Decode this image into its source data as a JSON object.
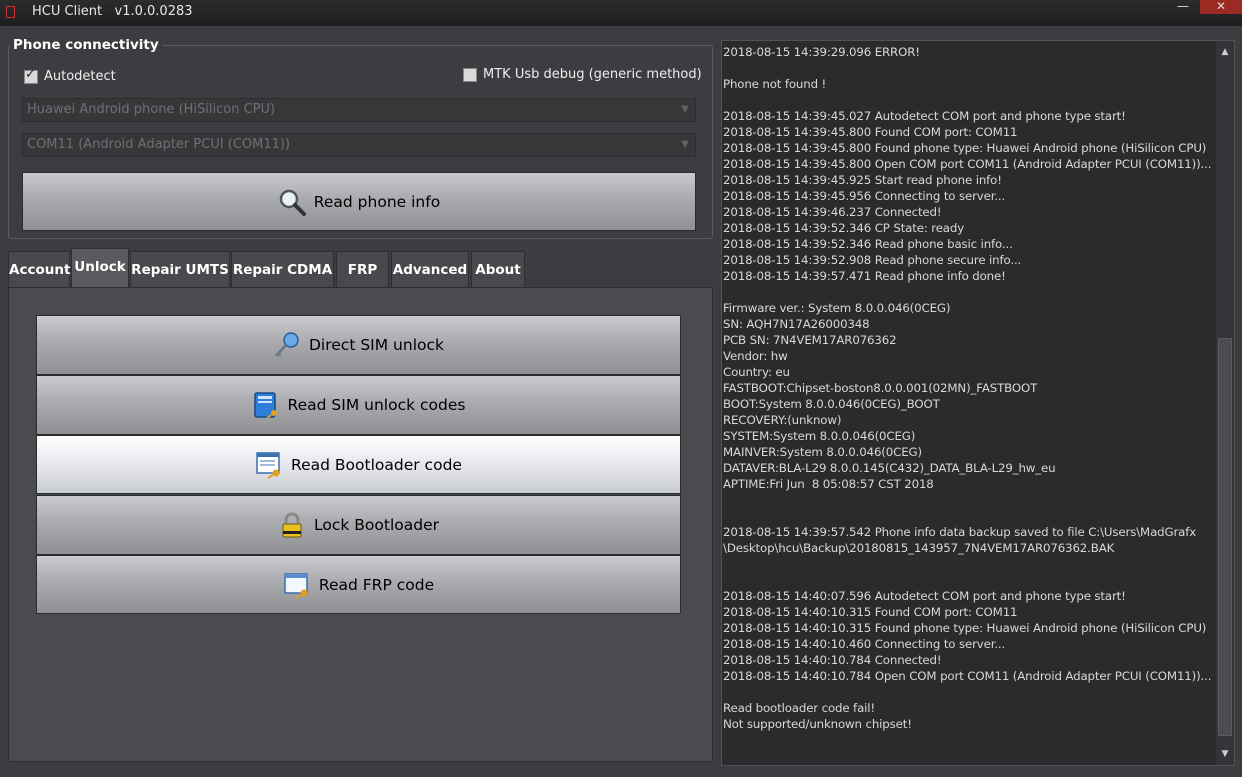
{
  "window": {
    "title": "HCU Client   v1.0.0.0283",
    "minimize": "—",
    "close": "✕"
  },
  "connectivity": {
    "title": "Phone connectivity",
    "autodetect_label": "Autodetect",
    "autodetect_checked": true,
    "mtk_label": "MTK Usb debug (generic method)",
    "mtk_checked": false,
    "phone_type": "Huawei Android phone (HiSilicon CPU)",
    "com_port": "COM11 (Android Adapter PCUI (COM11))",
    "read_info_label": "Read phone info"
  },
  "tabs": [
    "Account",
    "Unlock",
    "Repair UMTS",
    "Repair CDMA",
    "FRP",
    "Advanced",
    "About"
  ],
  "active_tab": "Unlock",
  "unlock": {
    "direct_sim": "Direct SIM unlock",
    "read_sim_codes": "Read SIM unlock codes",
    "read_bootloader": "Read Bootloader code",
    "lock_bootloader": "Lock Bootloader",
    "read_frp": "Read FRP code"
  },
  "log": {
    "text": "2018-08-15 14:39:29.096 ERROR!\n\nPhone not found !\n\n2018-08-15 14:39:45.027 Autodetect COM port and phone type start!\n2018-08-15 14:39:45.800 Found COM port: COM11\n2018-08-15 14:39:45.800 Found phone type: Huawei Android phone (HiSilicon CPU)\n2018-08-15 14:39:45.800 Open COM port COM11 (Android Adapter PCUI (COM11))...\n2018-08-15 14:39:45.925 Start read phone info!\n2018-08-15 14:39:45.956 Connecting to server...\n2018-08-15 14:39:46.237 Connected!\n2018-08-15 14:39:52.346 CP State: ready\n2018-08-15 14:39:52.346 Read phone basic info...\n2018-08-15 14:39:52.908 Read phone secure info...\n2018-08-15 14:39:57.471 Read phone info done!\n\nFirmware ver.: System 8.0.0.046(0CEG)\nSN: AQH7N17A26000348\nPCB SN: 7N4VEM17AR076362\nVendor: hw\nCountry: eu\nFASTBOOT:Chipset-boston8.0.0.001(02MN)_FASTBOOT\nBOOT:System 8.0.0.046(0CEG)_BOOT\nRECOVERY:(unknow)\nSYSTEM:System 8.0.0.046(0CEG)\nMAINVER:System 8.0.0.046(0CEG)\nDATAVER:BLA-L29 8.0.0.145(C432)_DATA_BLA-L29_hw_eu\nAPTIME:Fri Jun  8 05:08:57 CST 2018\n\n\n2018-08-15 14:39:57.542 Phone info data backup saved to file C:\\Users\\MadGrafx\n\\Desktop\\hcu\\Backup\\20180815_143957_7N4VEM17AR076362.BAK\n\n\n2018-08-15 14:40:07.596 Autodetect COM port and phone type start!\n2018-08-15 14:40:10.315 Found COM port: COM11\n2018-08-15 14:40:10.315 Found phone type: Huawei Android phone (HiSilicon CPU)\n2018-08-15 14:40:10.460 Connecting to server...\n2018-08-15 14:40:10.784 Connected!\n2018-08-15 14:40:10.784 Open COM port COM11 (Android Adapter PCUI (COM11))...\n\nRead bootloader code fail!\nNot supported/unknown chipset!"
  }
}
